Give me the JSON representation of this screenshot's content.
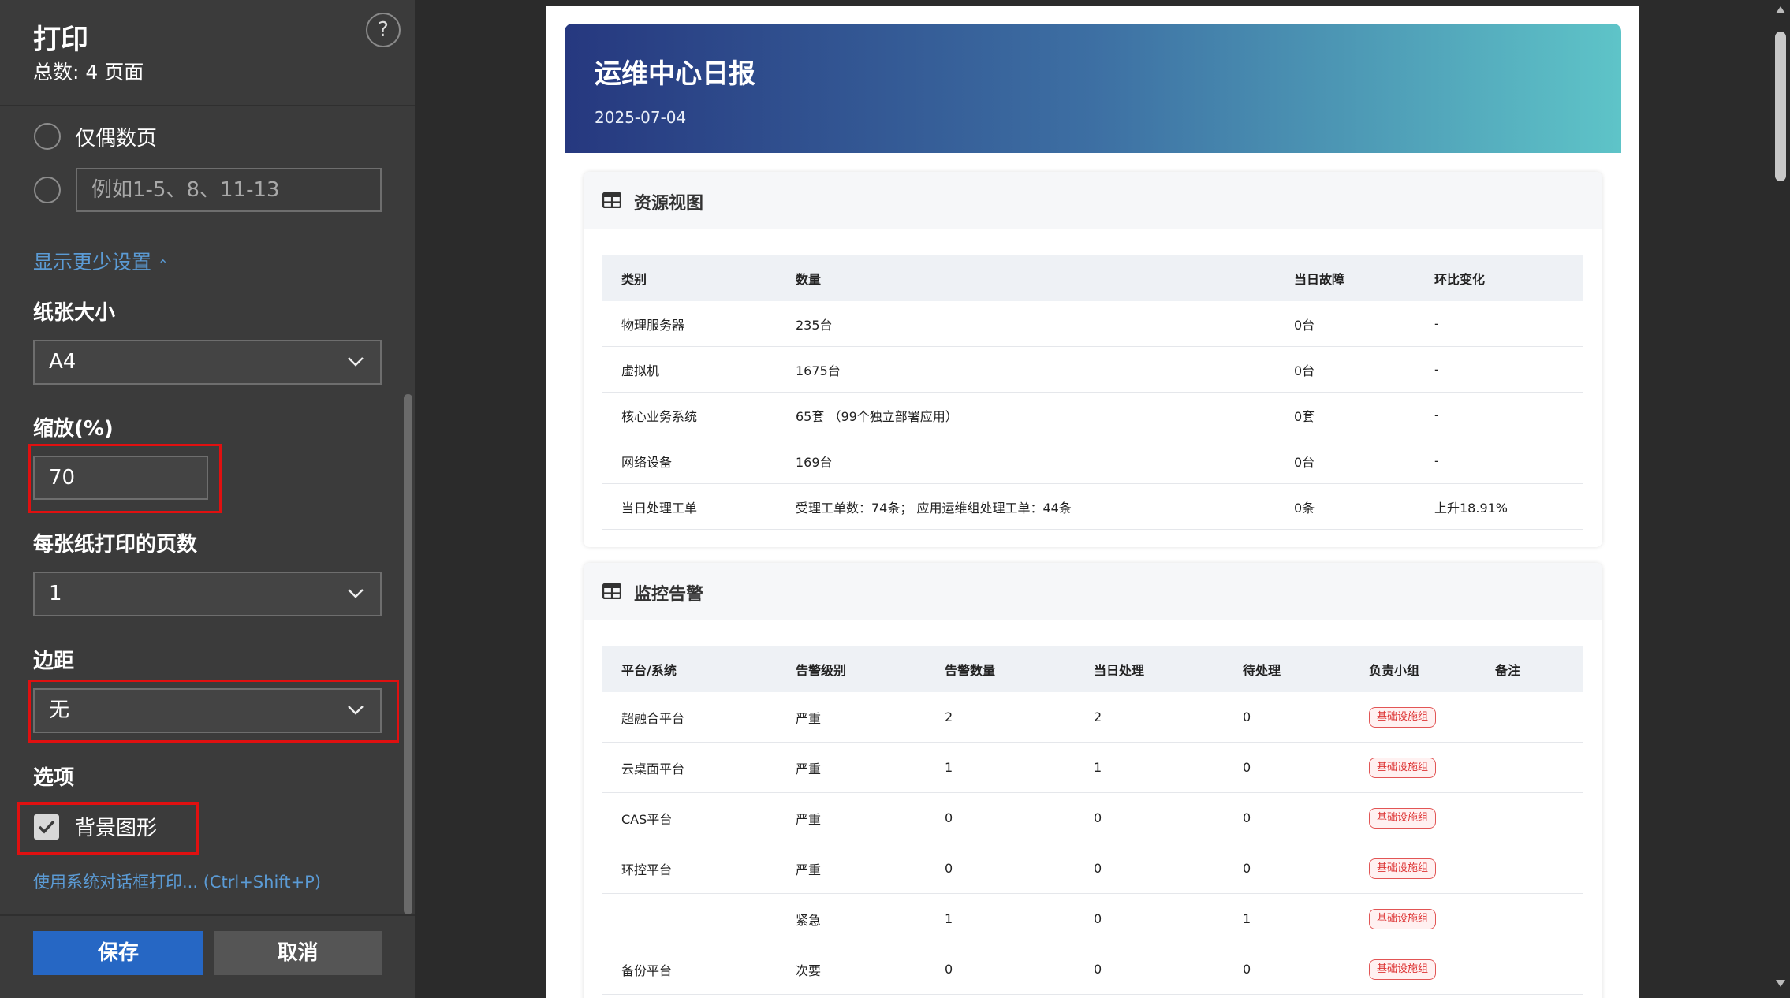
{
  "print_panel": {
    "title": "打印",
    "total": "总数: 4 页面",
    "help_icon": "?",
    "even_pages_label": "仅偶数页",
    "range_placeholder": "例如1-5、8、11-13",
    "show_less": "显示更少设置",
    "paper_size_label": "纸张大小",
    "paper_size_value": "A4",
    "scale_label": "缩放(%)",
    "scale_value": "70",
    "pages_per_sheet_label": "每张纸打印的页数",
    "pages_per_sheet_value": "1",
    "margins_label": "边距",
    "margins_value": "无",
    "options_label": "选项",
    "background_graphics_label": "背景图形",
    "background_graphics_checked": true,
    "system_dialog_link": "使用系统对话框打印... (Ctrl+Shift+P)",
    "save_button": "保存",
    "cancel_button": "取消"
  },
  "report": {
    "title": "运维中心日报",
    "date": "2025-07-04",
    "resources": {
      "title": "资源视图",
      "columns": [
        "类别",
        "数量",
        "当日故障",
        "环比变化"
      ],
      "rows": [
        [
          "物理服务器",
          "235台",
          "0台",
          "-"
        ],
        [
          "虚拟机",
          "1675台",
          "0台",
          "-"
        ],
        [
          "核心业务系统",
          "65套 （99个独立部署应用）",
          "0套",
          "-"
        ],
        [
          "网络设备",
          "169台",
          "0台",
          "-"
        ],
        [
          "当日处理工单",
          "受理工单数：74条； 应用运维组处理工单：44条",
          "0条",
          "上升18.91%"
        ]
      ]
    },
    "alerts": {
      "title": "监控告警",
      "columns": [
        "平台/系统",
        "告警级别",
        "告警数量",
        "当日处理",
        "待处理",
        "负责小组",
        "备注"
      ],
      "rows": [
        [
          "超融合平台",
          "严重",
          "2",
          "2",
          "0",
          "基础设施组",
          ""
        ],
        [
          "云桌面平台",
          "严重",
          "1",
          "1",
          "0",
          "基础设施组",
          ""
        ],
        [
          "CAS平台",
          "严重",
          "0",
          "0",
          "0",
          "基础设施组",
          ""
        ],
        [
          "环控平台",
          "严重",
          "0",
          "0",
          "0",
          "基础设施组",
          ""
        ],
        [
          "",
          "紧急",
          "1",
          "0",
          "1",
          "基础设施组",
          ""
        ],
        [
          "备份平台",
          "次要",
          "0",
          "0",
          "0",
          "基础设施组",
          ""
        ]
      ]
    }
  },
  "colors": {
    "panel_bg": "#3b3b3b",
    "accent": "#2667c4",
    "link": "#5b9bd5",
    "highlight_box": "#e01010",
    "banner_start": "#26387f",
    "banner_end": "#5ec4c8",
    "badge": "#e25555"
  },
  "icons": {
    "table_icon": "table-grid-icon",
    "dropdown": "chevron-down-icon",
    "show_less_chevron": "chevron-up-icon",
    "checkbox": "checkmark-icon"
  }
}
